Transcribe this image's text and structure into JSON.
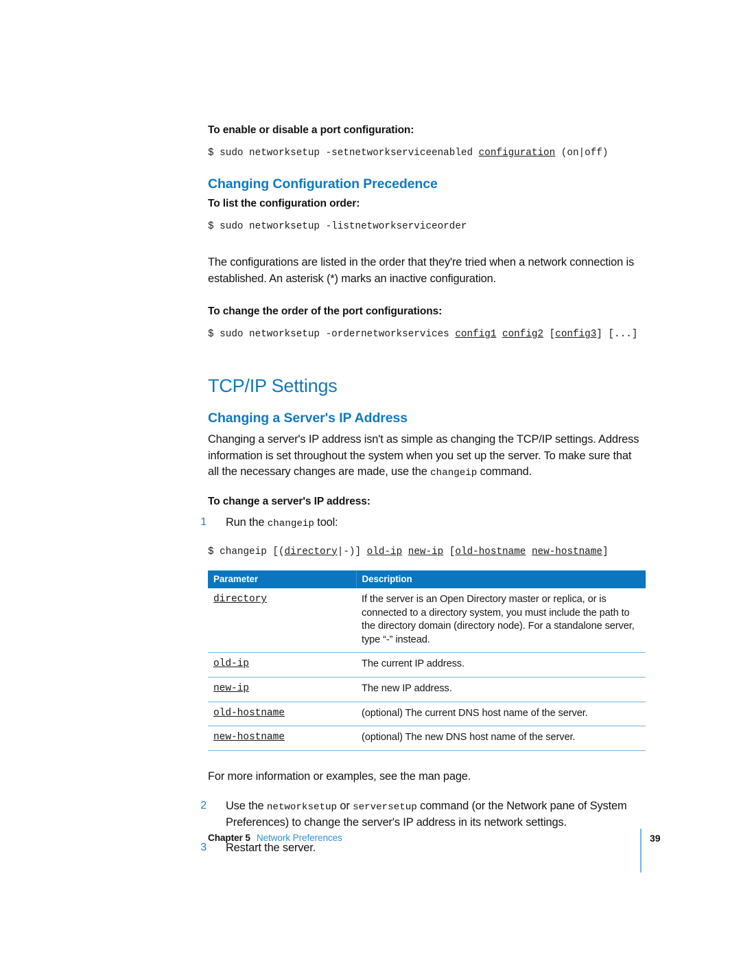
{
  "document": {
    "page_number": "39",
    "footer": {
      "chapter_label": "Chapter 5",
      "chapter_title": "Network Preferences"
    }
  },
  "colors": {
    "heading_blue": "#1178BE",
    "table_header_blue": "#0B76BE",
    "rule_blue": "#73B4DD",
    "footer_link_blue": "#2E93D4",
    "step_number_blue": "#1B7FC4"
  },
  "sections": {
    "enable_disable": {
      "procedure_heading": "To enable or disable a port configuration:",
      "command_prefix": "$ sudo networksetup -setnetworkserviceenabled ",
      "command_arg": "configuration",
      "command_suffix": " (on|off)"
    },
    "precedence": {
      "heading": "Changing Configuration Precedence",
      "list_order_heading": "To list the configuration order:",
      "list_order_command": "$ sudo networksetup -listnetworkserviceorder",
      "paragraph": "The configurations are listed in the order that they're tried when a network connection is established. An asterisk (*) marks an inactive configuration.",
      "change_order_heading": "To change the order of the port configurations:",
      "change_order_cmd_prefix": "$ sudo networksetup -ordernetworkservices ",
      "change_order_arg1": "config1",
      "change_order_arg2": "config2",
      "change_order_bracket_open": " [",
      "change_order_arg3": "config3",
      "change_order_bracket_close": "] [...]"
    },
    "tcpip": {
      "heading": "TCP/IP Settings",
      "subheading": "Changing a Server's IP Address",
      "paragraph_part1": "Changing a server's IP address isn't as simple as changing the TCP/IP settings. Address information is set throughout the system when you set up the server. To make sure that all the necessary changes are made, use the ",
      "paragraph_mono": "changeip",
      "paragraph_part2": " command.",
      "procedure_heading": "To change a server's IP address:",
      "step1": {
        "number": "1",
        "text_before": "Run the ",
        "mono": "changeip",
        "text_after": " tool:"
      },
      "changeip_command": {
        "p1": "$ changeip [(",
        "u1": "directory",
        "p2": "|-)] ",
        "u2": "old-ip",
        "p3": " ",
        "u3": "new-ip",
        "p4": " [",
        "u4": "old-hostname",
        "p5": " ",
        "u5": "new-hostname",
        "p6": "]"
      },
      "table": {
        "headers": [
          "Parameter",
          "Description"
        ],
        "rows": [
          {
            "parameter": "directory",
            "description": "If the server is an Open Directory master or replica, or is connected to a directory system, you must include the path to the directory domain (directory node). For a standalone server, type “-” instead."
          },
          {
            "parameter": "old-ip",
            "description": "The current IP address."
          },
          {
            "parameter": "new-ip",
            "description": "The new IP address."
          },
          {
            "parameter": "old-hostname",
            "description": "(optional) The current DNS host name of the server."
          },
          {
            "parameter": "new-hostname",
            "description": "(optional) The new DNS host name of the server."
          }
        ]
      },
      "man_page_note": "For more information or examples, see the man page.",
      "step2": {
        "number": "2",
        "t1": "Use the ",
        "m1": "networksetup",
        "t2": " or ",
        "m2": "serversetup",
        "t3": " command (or the Network pane of System Preferences) to change the server's IP address in its network settings."
      },
      "step3": {
        "number": "3",
        "text": "Restart the server."
      }
    }
  }
}
